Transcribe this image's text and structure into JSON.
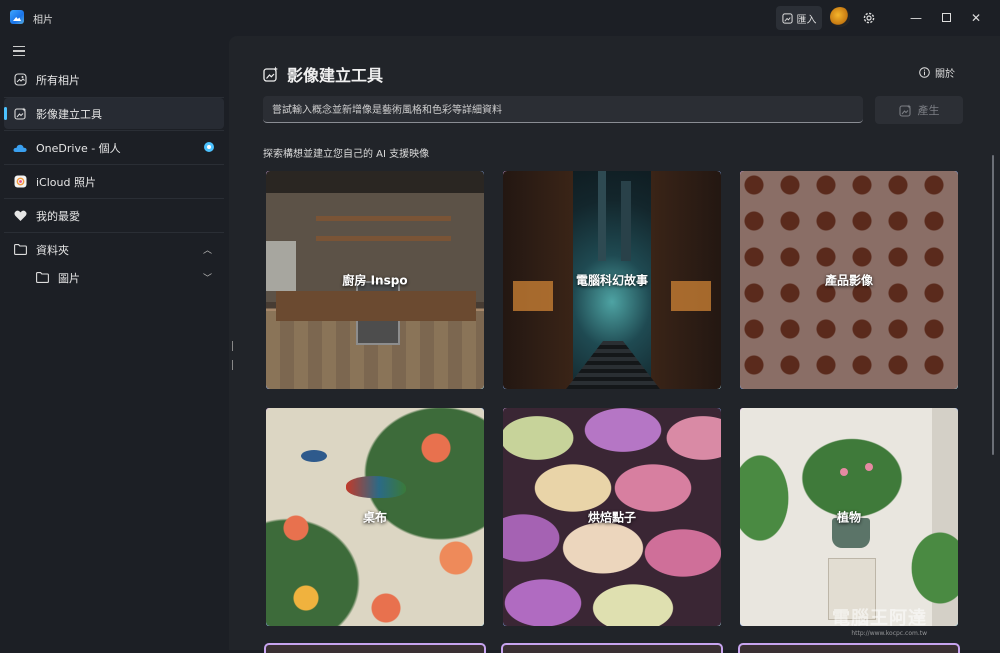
{
  "window": {
    "title": "相片",
    "import_label": "匯入"
  },
  "sidebar": {
    "items": [
      {
        "label": "所有相片",
        "icon": "photo-icon"
      },
      {
        "label": "影像建立工具",
        "icon": "image-create-icon"
      },
      {
        "label": "OneDrive - 個人",
        "icon": "onedrive-icon"
      },
      {
        "label": "iCloud 照片",
        "icon": "icloud-icon"
      },
      {
        "label": "我的最愛",
        "icon": "heart-icon"
      },
      {
        "label": "資料夾",
        "icon": "folder-icon"
      },
      {
        "label": "圖片",
        "icon": "folder-icon"
      }
    ]
  },
  "main": {
    "title": "影像建立工具",
    "about_label": "關於",
    "prompt_placeholder": "嘗試輸入概念並新增像是藝術風格和色彩等詳細資料",
    "generate_label": "產生",
    "explore_label": "探索構想並建立您自己的 AI 支援映像",
    "tiles": [
      {
        "label": "廚房 Inspo"
      },
      {
        "label": "電腦科幻故事"
      },
      {
        "label": "產品影像"
      },
      {
        "label": "桌布"
      },
      {
        "label": "烘焙點子"
      },
      {
        "label": "植物"
      }
    ]
  },
  "watermark": {
    "text": "電腦王阿達",
    "url": "http://www.kocpc.com.tw"
  },
  "colors": {
    "accent": "#4cc2ff",
    "background": "#1c1f25",
    "panel": "#212429"
  }
}
